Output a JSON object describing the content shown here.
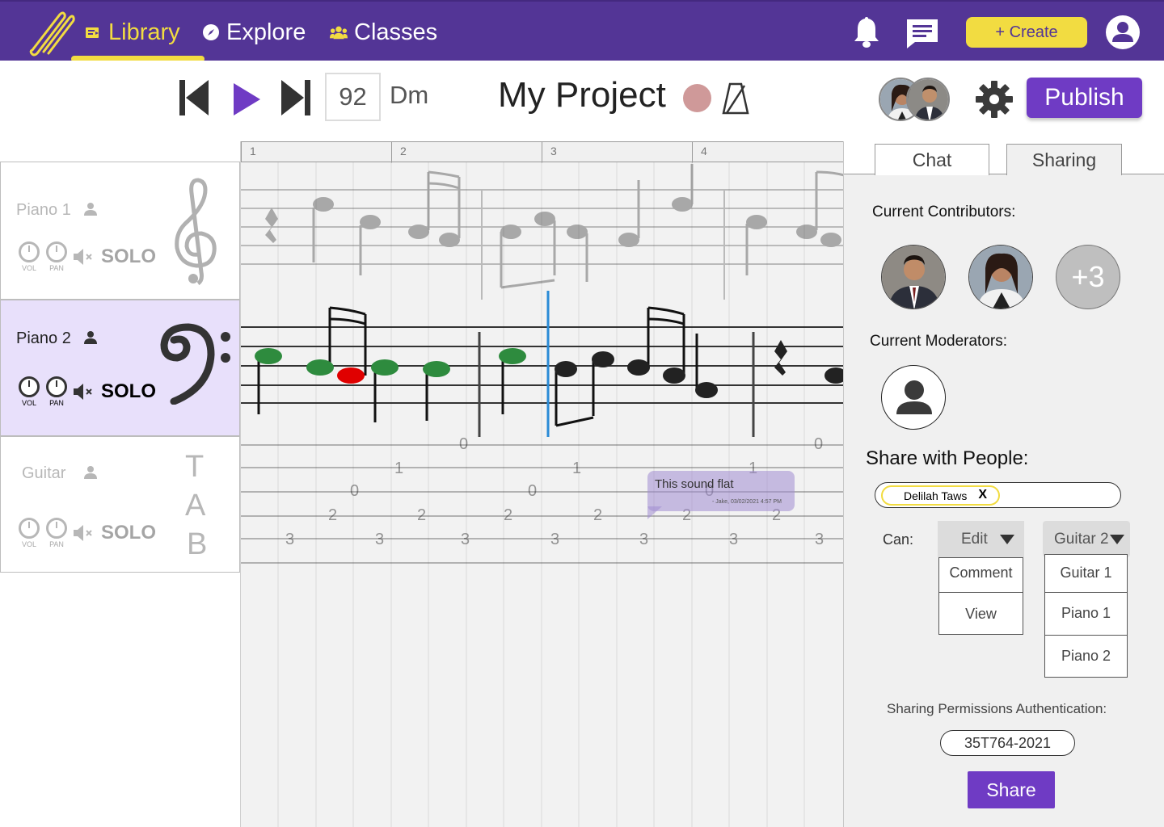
{
  "nav": {
    "items": [
      {
        "label": "Library",
        "icon": "library-icon",
        "active": true
      },
      {
        "label": "Explore",
        "icon": "compass-icon",
        "active": false
      },
      {
        "label": "Classes",
        "icon": "people-icon",
        "active": false
      }
    ],
    "create_label": "+ Create",
    "accent": "#f2dc41",
    "bar_color": "#533596"
  },
  "toolbar": {
    "tempo": "92",
    "key": "Dm",
    "project_title": "My Project",
    "publish_label": "Publish"
  },
  "tracks": [
    {
      "name": "Piano 1",
      "vol": "VOL",
      "pan": "PAN",
      "solo": "SOLO",
      "clef": "treble-clef-icon"
    },
    {
      "name": "Piano 2",
      "vol": "VOL",
      "pan": "PAN",
      "solo": "SOLO",
      "clef": "bass-clef-icon"
    },
    {
      "name": "Guitar",
      "vol": "VOL",
      "pan": "PAN",
      "solo": "SOLO",
      "tab": [
        "T",
        "A",
        "B"
      ]
    }
  ],
  "ruler": [
    "1",
    "2",
    "3",
    "4"
  ],
  "tab_numbers": {
    "row0": "0",
    "row1": "1",
    "row2": "2",
    "row3": "3"
  },
  "comment": {
    "text": "This sound flat",
    "meta": "- Jake, 03/02/2021 4:57 PM"
  },
  "panel": {
    "tabs": [
      "Chat",
      "Sharing"
    ],
    "contributors_label": "Current Contributors:",
    "more_count": "+3",
    "moderators_label": "Current Moderators:",
    "share_with_label": "Share with People:",
    "chip_name": "Delilah Taws",
    "chip_remove": "X",
    "can_label": "Can:",
    "permission": {
      "selected": "Edit",
      "options": [
        "Comment",
        "View"
      ]
    },
    "track": {
      "selected": "Guitar 2",
      "options": [
        "Guitar 1",
        "Piano 1",
        "Piano 2"
      ]
    },
    "auth_label": "Sharing Permissions Authentication:",
    "auth_code": "35T764-2021",
    "share_label": "Share"
  }
}
